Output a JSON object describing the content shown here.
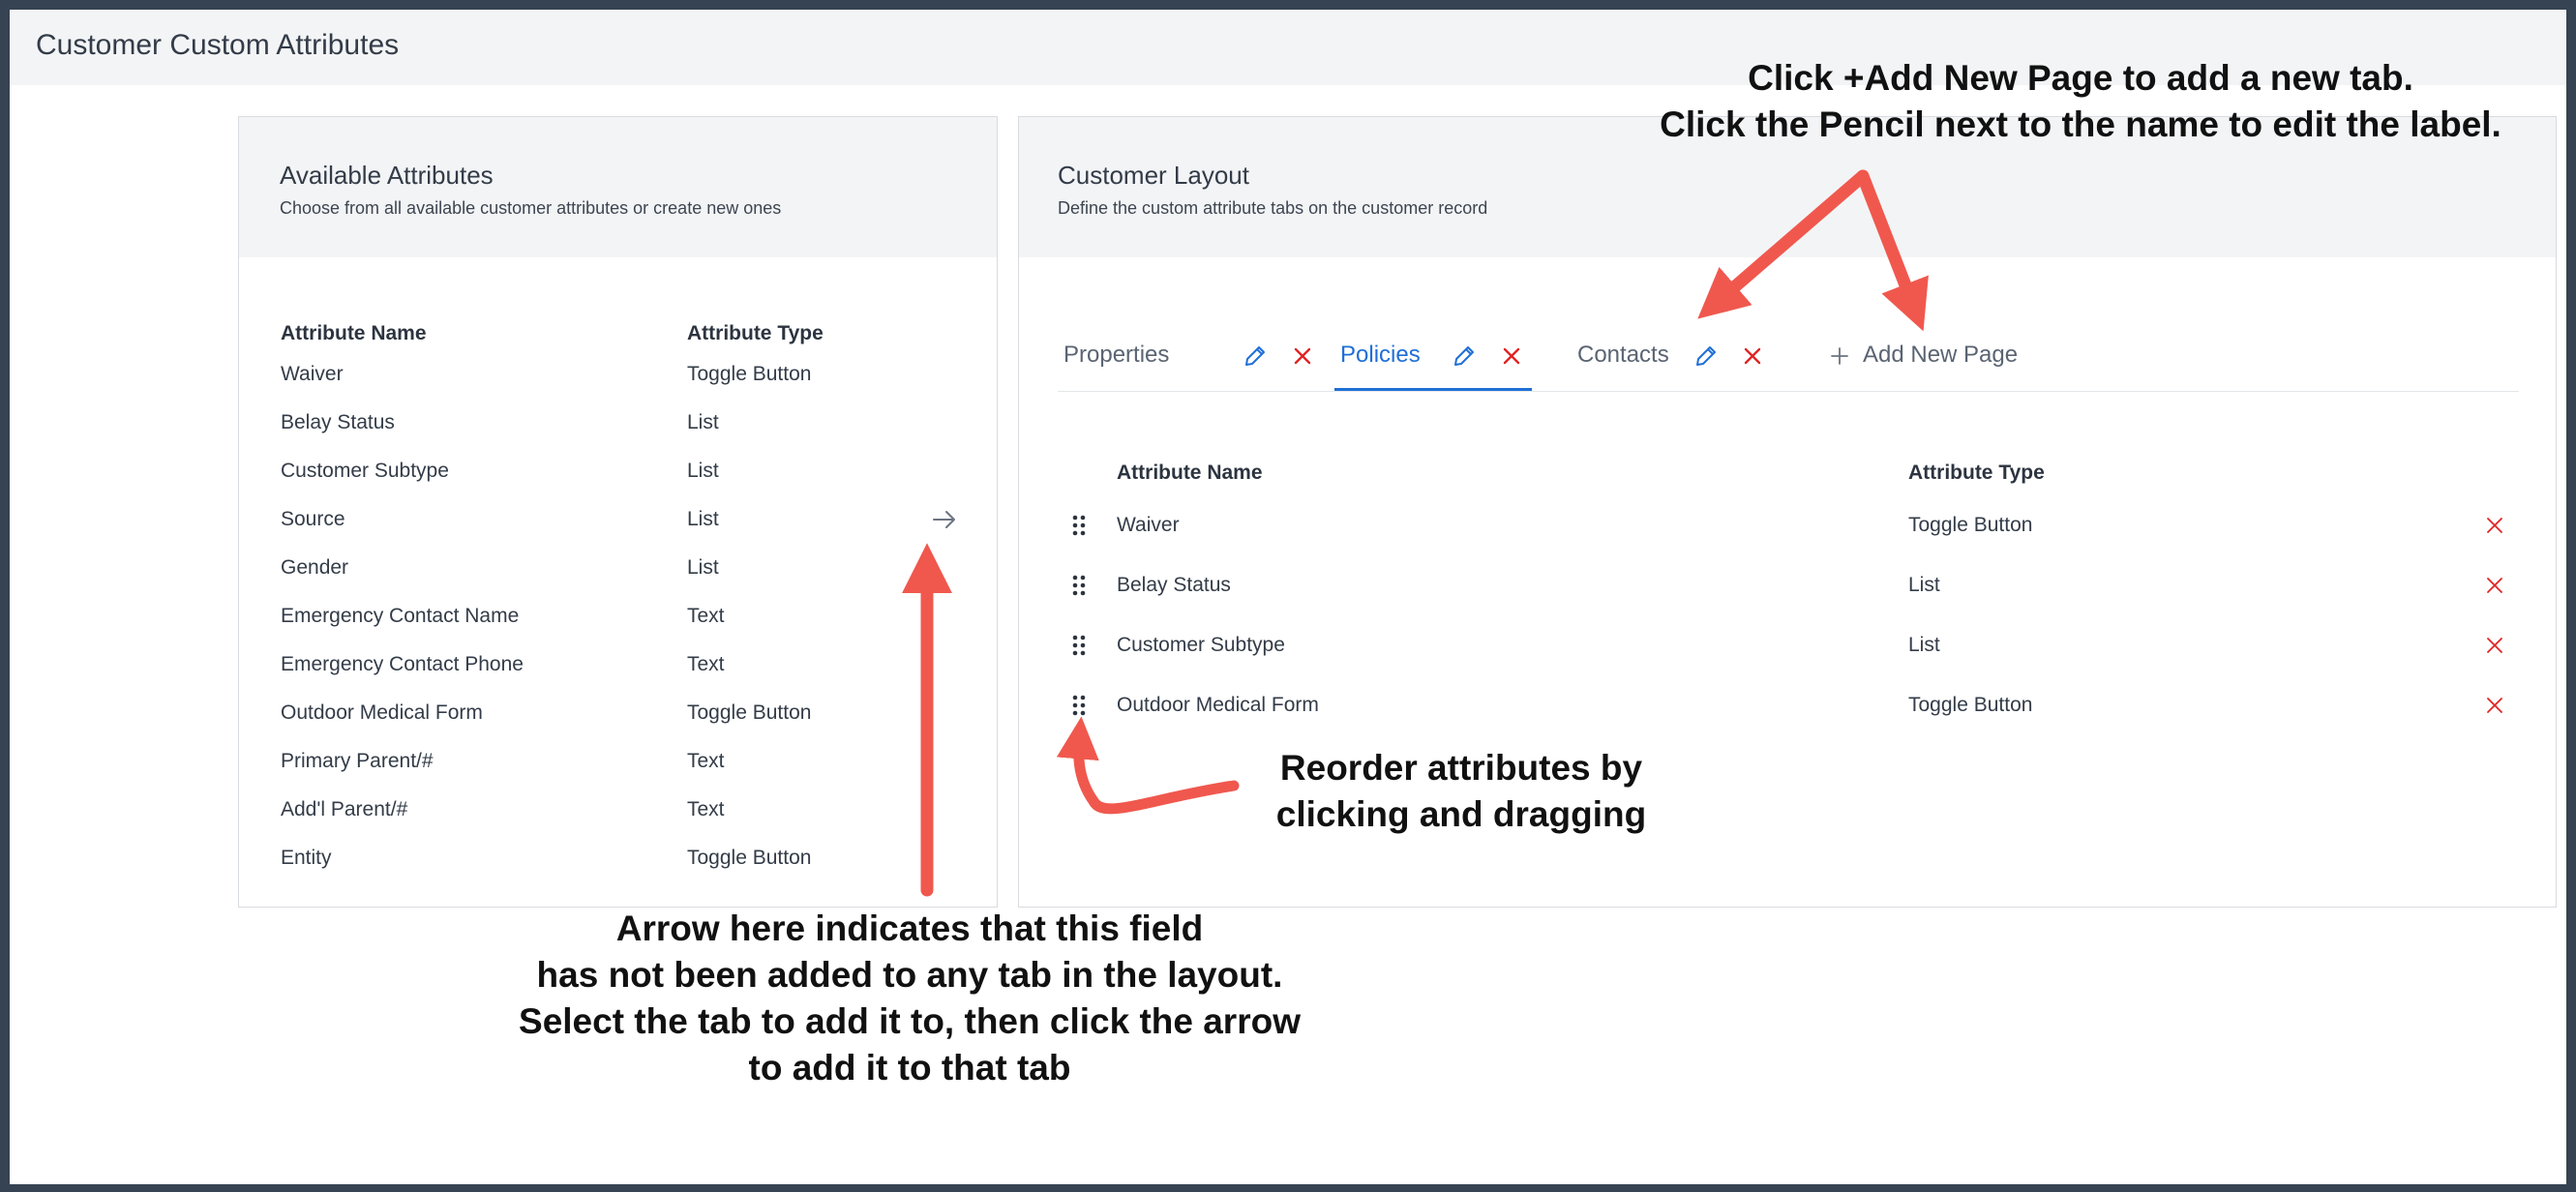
{
  "page": {
    "title": "Customer Custom Attributes"
  },
  "available": {
    "title": "Available Attributes",
    "subtitle": "Choose from all available customer attributes or create new ones",
    "headers": {
      "name": "Attribute Name",
      "type": "Attribute Type"
    },
    "rows": [
      {
        "name": "Waiver",
        "type": "Toggle Button"
      },
      {
        "name": "Belay Status",
        "type": "List"
      },
      {
        "name": "Customer Subtype",
        "type": "List"
      },
      {
        "name": "Source",
        "type": "List"
      },
      {
        "name": "Gender",
        "type": "List"
      },
      {
        "name": "Emergency Contact Name",
        "type": "Text"
      },
      {
        "name": "Emergency Contact Phone",
        "type": "Text"
      },
      {
        "name": "Outdoor Medical Form",
        "type": "Toggle Button"
      },
      {
        "name": "Primary Parent/#",
        "type": "Text"
      },
      {
        "name": "Add'l Parent/#",
        "type": "Text"
      },
      {
        "name": "Entity",
        "type": "Toggle Button"
      }
    ],
    "add_arrow_icon": "arrow-right-icon"
  },
  "layout": {
    "title": "Customer Layout",
    "subtitle": "Define the custom attribute tabs on the customer record",
    "tabs": [
      {
        "label": "Properties"
      },
      {
        "label": "Policies"
      },
      {
        "label": "Contacts"
      }
    ],
    "add_page_label": "Add New Page",
    "headers": {
      "name": "Attribute Name",
      "type": "Attribute Type"
    },
    "rows": [
      {
        "name": "Waiver",
        "type": "Toggle Button"
      },
      {
        "name": "Belay Status",
        "type": "List"
      },
      {
        "name": "Customer Subtype",
        "type": "List"
      },
      {
        "name": "Outdoor Medical Form",
        "type": "Toggle Button"
      }
    ]
  },
  "annotations": {
    "top_line1": "Click +Add New Page to add a new tab.",
    "top_line2": "Click the Pencil next to the name to edit the label.",
    "reorder_line1": "Reorder attributes by",
    "reorder_line2": "clicking and  dragging",
    "arrow_line1": "Arrow here indicates that this field",
    "arrow_line2": "has not been added to any tab in the layout.",
    "arrow_line3": "Select the tab to add it to, then click the arrow",
    "arrow_line4": "to add it to that tab"
  },
  "colors": {
    "accent_blue": "#1f6fd6",
    "delete_red": "#e02424",
    "annotation_arrow": "#f0584e",
    "frame_border": "#364352"
  }
}
